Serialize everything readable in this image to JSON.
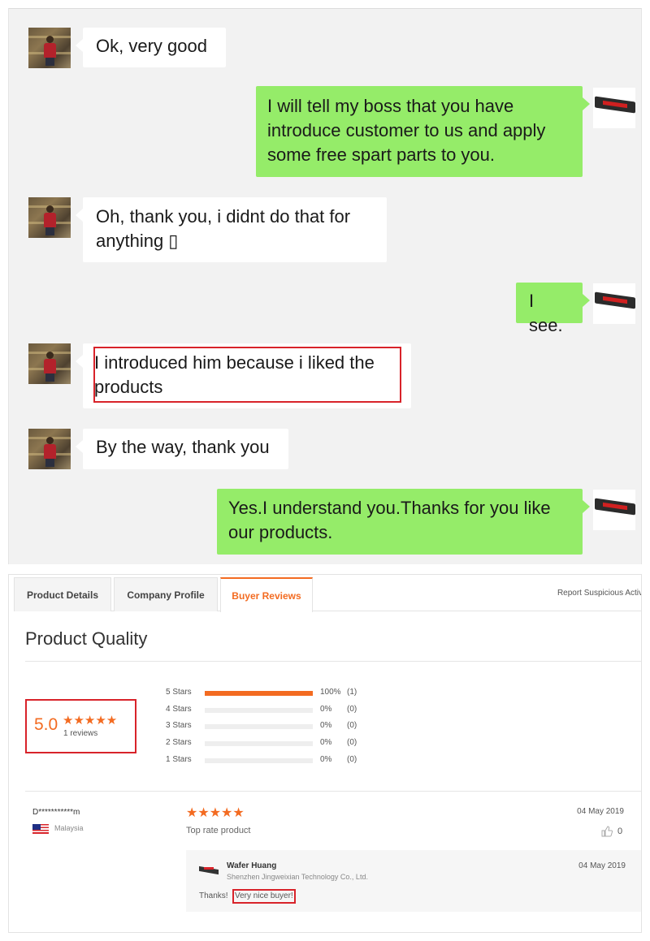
{
  "chat": {
    "messages": [
      {
        "side": "in",
        "text": "Ok, very good"
      },
      {
        "side": "out",
        "text": "I will tell my boss that you have introduce customer to us and apply some free spart parts to you."
      },
      {
        "side": "in",
        "text": "Oh, thank you, i didnt do that for anything ▯"
      },
      {
        "side": "out",
        "text": "I see."
      },
      {
        "side": "in",
        "text": "I introduced him because i liked the products"
      },
      {
        "side": "in",
        "text": "By the way, thank you"
      },
      {
        "side": "out",
        "text": "Yes.I understand you.Thanks for you like our products."
      }
    ]
  },
  "reviews": {
    "tabs": [
      "Product Details",
      "Company Profile",
      "Buyer Reviews"
    ],
    "active_tab": "Buyer Reviews",
    "report_link": "Report Suspicious Activ",
    "section_title": "Product Quality",
    "rating": {
      "score": "5.0",
      "stars": "★★★★★",
      "count_label": "1 reviews"
    },
    "distribution": [
      {
        "label": "5 Stars",
        "fraction": 1.0,
        "pct": "100%",
        "count": "(1)"
      },
      {
        "label": "4 Stars",
        "fraction": 0.0,
        "pct": "0%",
        "count": "(0)"
      },
      {
        "label": "3 Stars",
        "fraction": 0.0,
        "pct": "0%",
        "count": "(0)"
      },
      {
        "label": "2 Stars",
        "fraction": 0.0,
        "pct": "0%",
        "count": "(0)"
      },
      {
        "label": "1 Stars",
        "fraction": 0.0,
        "pct": "0%",
        "count": "(0)"
      }
    ],
    "review": {
      "user": "D***********m",
      "country": "Malaysia",
      "stars": "★★★★★",
      "text": "Top rate product",
      "date": "04 May 2019",
      "likes": "0"
    },
    "reply": {
      "name": "Wafer Huang",
      "company": "Shenzhen Jingweixian Technology Co., Ltd.",
      "date": "04 May 2019",
      "thanks": "Thanks!",
      "highlight": "Very nice buyer!"
    }
  },
  "colors": {
    "accent": "#f36b21",
    "highlight_box": "#d8232a",
    "chat_out_bubble": "#95ec69",
    "chat_background": "#f2f2f2"
  },
  "icons": [
    "profile-photo-icon",
    "machine-avatar-icon",
    "star-icon",
    "malaysia-flag-icon",
    "thumbs-up-icon",
    "company-logo-icon"
  ]
}
